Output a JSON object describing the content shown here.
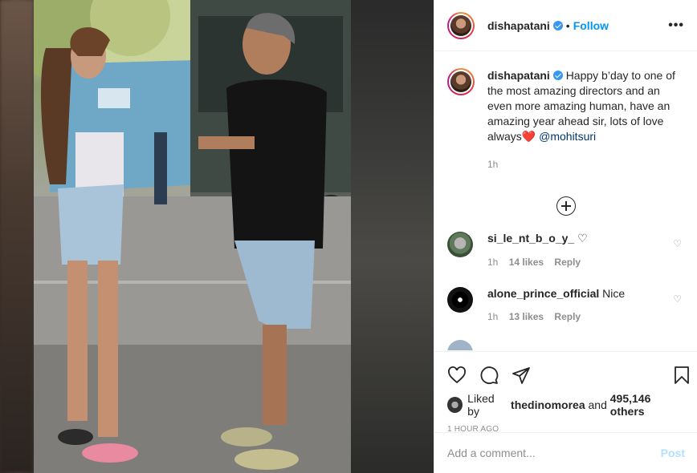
{
  "post": {
    "username": "dishapatani",
    "follow_label": "Follow",
    "more_label": "•••",
    "caption_user": "dishapatani",
    "caption_text": "Happy b’day to one of the most amazing directors and an even more amazing human, have an amazing year ahead sir, lots of love always",
    "caption_emoji": "❤️",
    "caption_mention": "@mohitsuri",
    "caption_time": "1h"
  },
  "comments": [
    {
      "user": "si_le_nt_b_o_y_",
      "text": "♡",
      "time": "1h",
      "likes": "14 likes",
      "reply": "Reply"
    },
    {
      "user": "alone_prince_official",
      "text": "Nice",
      "time": "1h",
      "likes": "13 likes",
      "reply": "Reply"
    }
  ],
  "likes": {
    "prefix": "Liked by",
    "user": "thedinomorea",
    "and": "and",
    "others": "495,146 others"
  },
  "date": "1 HOUR AGO",
  "add_comment": {
    "placeholder": "Add a comment...",
    "post_label": "Post"
  },
  "colors": {
    "accent": "#0095f6",
    "post_disabled": "#b2dffc",
    "heart": "#ed4956"
  },
  "icons": [
    "heart-icon",
    "comment-icon",
    "share-icon",
    "bookmark-icon",
    "plus-circle-icon",
    "verified-badge-icon"
  ]
}
